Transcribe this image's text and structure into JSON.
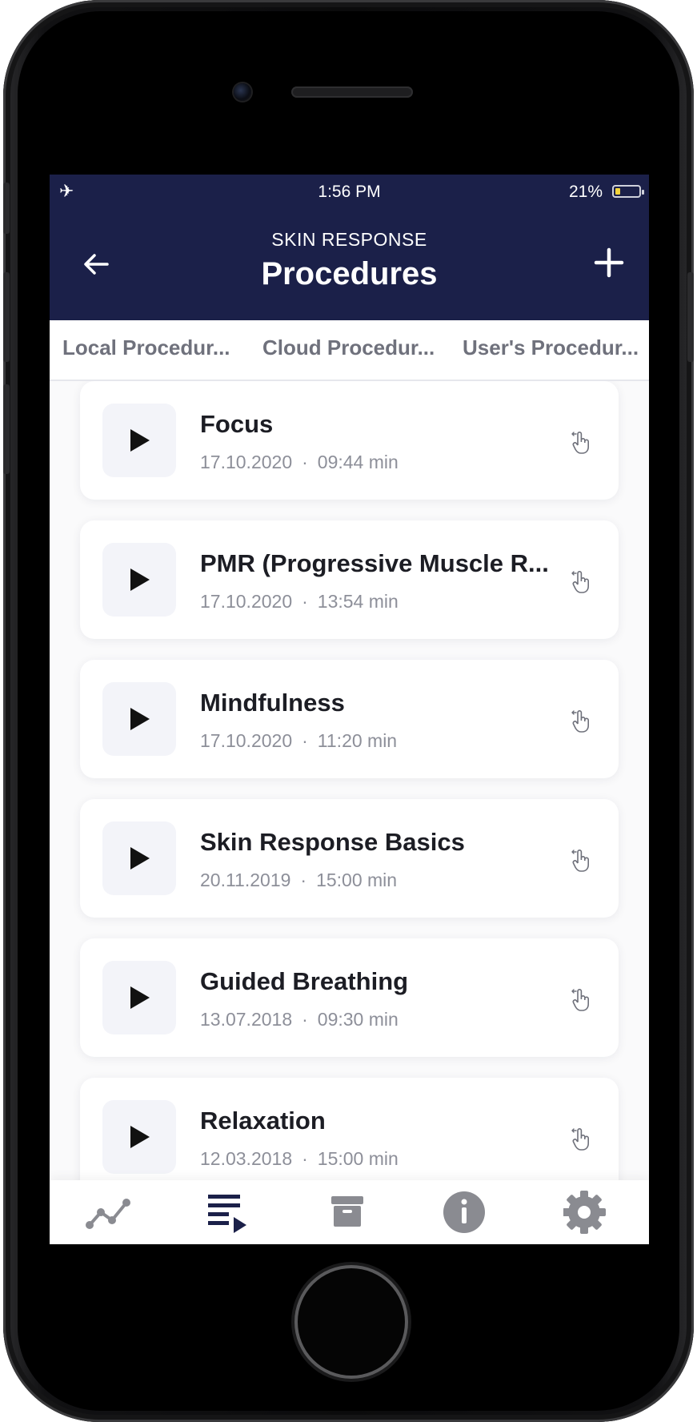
{
  "status_bar": {
    "time": "1:56 PM",
    "battery": "21%",
    "battery_level": 0.21
  },
  "header": {
    "subtitle": "SKIN RESPONSE",
    "title": "Procedures"
  },
  "tabs": [
    {
      "label": "Local Procedur...",
      "active": true
    },
    {
      "label": "Cloud Procedur...",
      "active": false
    },
    {
      "label": "User's Procedur...",
      "active": false
    }
  ],
  "procedures": [
    {
      "title": "Focus",
      "date": "17.10.2020",
      "duration": "09:44 min"
    },
    {
      "title": "PMR (Progressive Muscle R...",
      "date": "17.10.2020",
      "duration": "13:54 min"
    },
    {
      "title": "Mindfulness",
      "date": "17.10.2020",
      "duration": "11:20 min"
    },
    {
      "title": "Skin Response Basics",
      "date": "20.11.2019",
      "duration": "15:00 min"
    },
    {
      "title": "Guided Breathing",
      "date": "13.07.2018",
      "duration": "09:30 min"
    },
    {
      "title": "Relaxation",
      "date": "12.03.2018",
      "duration": "15:00 min"
    }
  ],
  "bottom_nav": [
    {
      "icon": "chart-line-icon",
      "active": false
    },
    {
      "icon": "playlist-icon",
      "active": true
    },
    {
      "icon": "archive-icon",
      "active": false
    },
    {
      "icon": "info-icon",
      "active": false
    },
    {
      "icon": "settings-gear-icon",
      "active": false
    }
  ],
  "colors": {
    "header_bg": "#1b2049",
    "accent": "#1b2049",
    "inactive_icon": "#8a8b91"
  }
}
